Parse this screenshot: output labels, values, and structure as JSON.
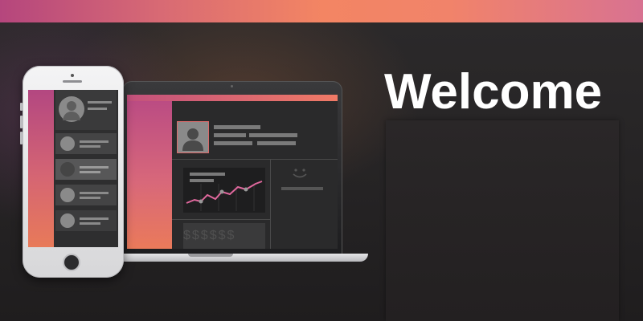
{
  "header": {
    "accent_gradient": [
      "#b5467d",
      "#f38563",
      "#d87291"
    ]
  },
  "hero": {
    "title": "Welcome"
  },
  "illustration": {
    "laptop": {
      "dollar_pattern": "$$$$$$"
    },
    "icons": [
      "user-avatar-icon",
      "line-chart-icon",
      "smile-icon",
      "dollar-icon"
    ]
  },
  "colors": {
    "background": "#2a2829",
    "panel": "#262324",
    "text": "#ffffff",
    "chart_line": "#e0689d"
  }
}
